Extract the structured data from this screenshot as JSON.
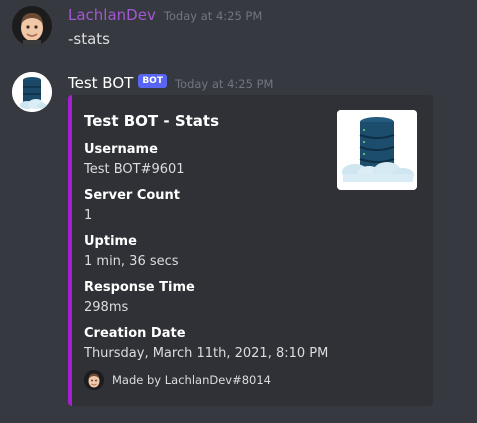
{
  "messages": [
    {
      "author": "LachlanDev",
      "timestamp": "Today at 4:25 PM",
      "content": "-stats",
      "author_color": "#a358d1"
    },
    {
      "author": "Test BOT",
      "badge": "BOT",
      "timestamp": "Today at 4:25 PM"
    }
  ],
  "embed": {
    "accent_color": "#a61fd1",
    "title": "Test BOT - Stats",
    "fields": [
      {
        "name": "Username",
        "value": "Test BOT#9601"
      },
      {
        "name": "Server Count",
        "value": "1"
      },
      {
        "name": "Uptime",
        "value": "1 min, 36 secs"
      },
      {
        "name": "Response Time",
        "value": "298ms"
      },
      {
        "name": "Creation Date",
        "value": "Thursday, March 11th, 2021, 8:10 PM"
      }
    ],
    "footer": "Made by LachlanDev#8014",
    "thumbnail_icon": "server-cloud-icon"
  },
  "colors": {
    "background": "#36393f",
    "embed_background": "#2f3136",
    "bot_badge": "#5865f2"
  }
}
